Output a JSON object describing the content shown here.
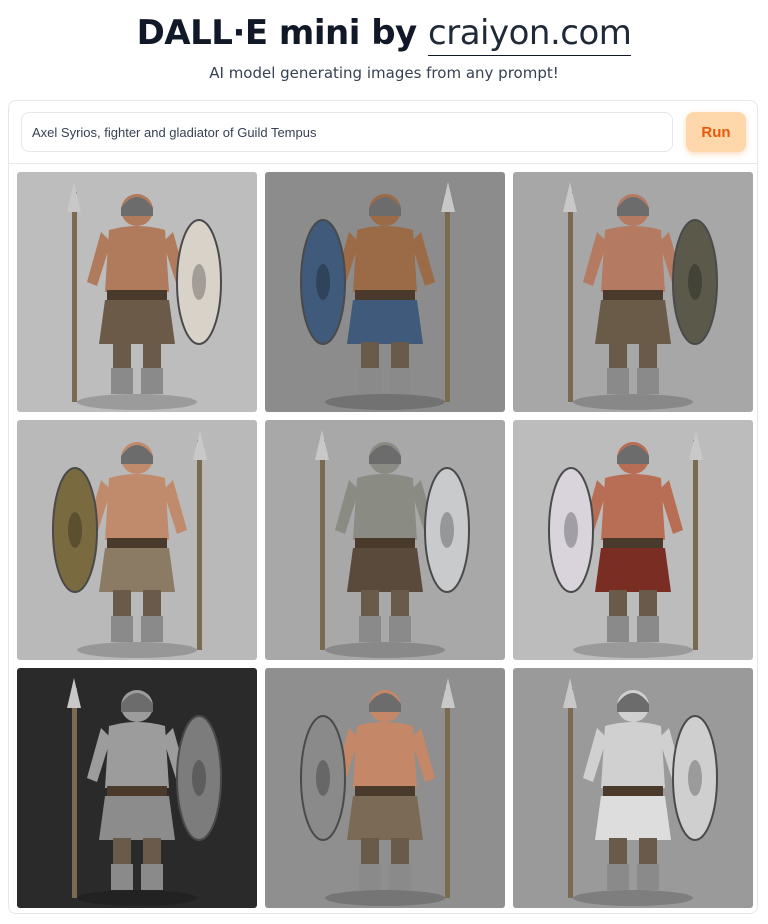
{
  "header": {
    "title_main": "DALL·E mini by",
    "title_brand": "craiyon.com",
    "subtitle": "AI model generating images from any prompt!"
  },
  "prompt": {
    "value": "Axel Syrios, fighter and gladiator of Guild Tempus",
    "run_label": "Run"
  },
  "images": [
    {
      "bg": "#bdbdbd",
      "skin": "#b07a5c",
      "armor": "#6b5a48",
      "shield": "#d8d2c8"
    },
    {
      "bg": "#8c8c8c",
      "skin": "#9b6a47",
      "armor": "#3f5a7a",
      "shield": "#3f5a7a"
    },
    {
      "bg": "#a7a7a7",
      "skin": "#b47a62",
      "armor": "#6a5a48",
      "shield": "#5b5a4a"
    },
    {
      "bg": "#b9b9b9",
      "skin": "#c08b6c",
      "armor": "#8c7b64",
      "shield": "#7a6a40"
    },
    {
      "bg": "#a8a8a8",
      "skin": "#8a8c84",
      "armor": "#5a4a3c",
      "shield": "#c9cacc"
    },
    {
      "bg": "#bcbcbc",
      "skin": "#b86d55",
      "armor": "#7a2e23",
      "shield": "#d9d3dc"
    },
    {
      "bg": "#2a2a2a",
      "skin": "#9c9c9c",
      "armor": "#8c8c8c",
      "shield": "#7c7c7c"
    },
    {
      "bg": "#8f8f8f",
      "skin": "#c48768",
      "armor": "#7b6a56",
      "shield": "#8a8a8a"
    },
    {
      "bg": "#9a9a9a",
      "skin": "#d0d0d0",
      "armor": "#dddddd",
      "shield": "#cfcfcf"
    }
  ]
}
